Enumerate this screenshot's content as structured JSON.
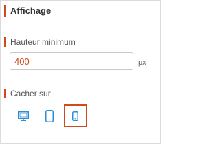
{
  "section": {
    "title": "Affichage"
  },
  "min_height": {
    "label": "Hauteur minimum",
    "value": "400",
    "unit": "px"
  },
  "hide_on": {
    "label": "Cacher sur",
    "devices": [
      {
        "icon": "desktop-icon",
        "selected": false
      },
      {
        "icon": "tablet-icon",
        "selected": false
      },
      {
        "icon": "mobile-icon",
        "selected": true
      }
    ]
  },
  "colors": {
    "accent": "#d2491e",
    "icon": "#2a8fd6"
  }
}
